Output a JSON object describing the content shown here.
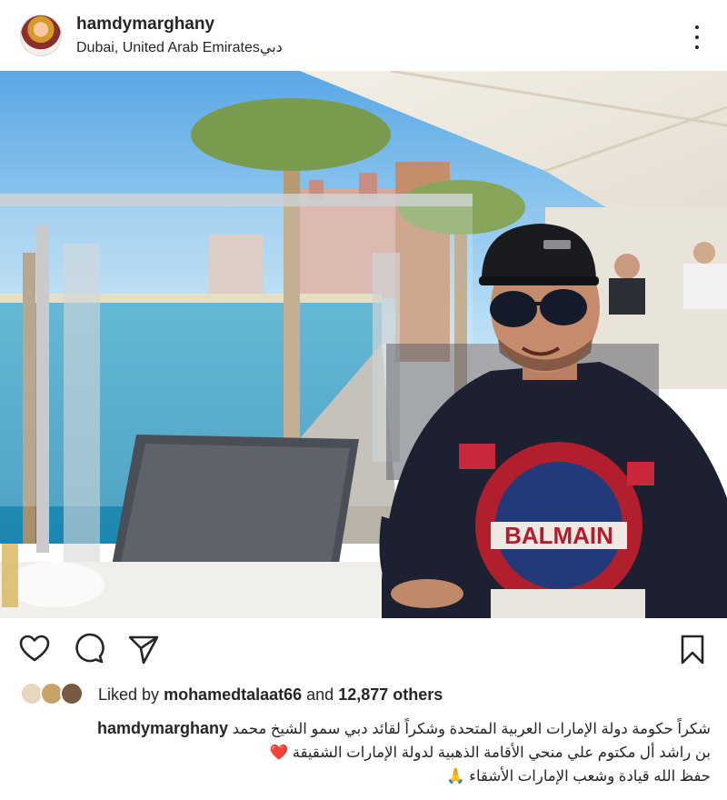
{
  "post": {
    "username": "hamdymarghany",
    "location": "Dubai, United Arab Emirates",
    "location_ar": "دبي"
  },
  "icons": {
    "more": "more-vertical-icon",
    "like": "heart-outline-icon",
    "comment": "comment-bubble-icon",
    "share": "paper-plane-icon",
    "save": "bookmark-icon"
  },
  "likes": {
    "prefix": "Liked by",
    "user": "mohamedtalaat66",
    "joiner": "and",
    "others": "12,877 others"
  },
  "caption": {
    "username": "hamdymarghany",
    "line1": "شكراً حكومة دولة الإمارات العربية المتحدة وشكراً لقائد دبي سمو الشيخ محمد",
    "line2": "بن راشد أل مكتوم علي منحي الأقامة الذهبية لدولة الإمارات الشقيقة",
    "heart_emoji": "❤️",
    "line3": "حفظ الله قيادة وشعب الإمارات الأشقاء",
    "pray_emoji": "🙏"
  },
  "colors": {
    "text": "#262626",
    "muted": "#8e8e8e",
    "heart": "#e0245e"
  }
}
